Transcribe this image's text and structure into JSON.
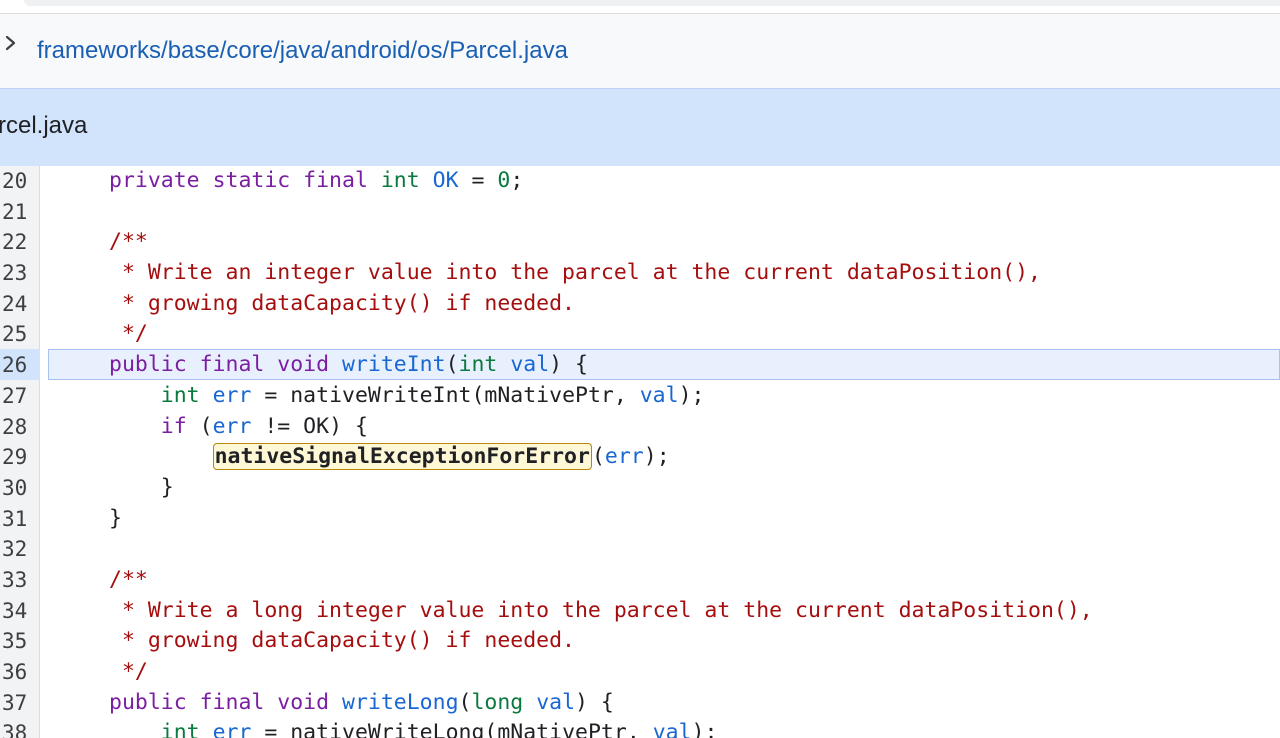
{
  "breadcrumb": {
    "path": "frameworks/base/core/java/android/os/Parcel.java"
  },
  "file_header": {
    "title": "rcel.java"
  },
  "code": {
    "highlighted_line": 26,
    "lines": [
      {
        "n": 20,
        "tokens": [
          {
            "t": "private ",
            "c": "kw"
          },
          {
            "t": "static ",
            "c": "kw"
          },
          {
            "t": "final ",
            "c": "kw"
          },
          {
            "t": "int ",
            "c": "ty"
          },
          {
            "t": "OK",
            "c": "fn"
          },
          {
            "t": " = ",
            "c": ""
          },
          {
            "t": "0",
            "c": "nm"
          },
          {
            "t": ";",
            "c": ""
          }
        ]
      },
      {
        "n": 21,
        "tokens": []
      },
      {
        "n": 22,
        "tokens": [
          {
            "t": "/**",
            "c": "cm"
          }
        ]
      },
      {
        "n": 23,
        "tokens": [
          {
            "t": " * Write an integer value into the parcel at the current dataPosition(),",
            "c": "cm"
          }
        ]
      },
      {
        "n": 24,
        "tokens": [
          {
            "t": " * growing dataCapacity() if needed.",
            "c": "cm"
          }
        ]
      },
      {
        "n": 25,
        "tokens": [
          {
            "t": " */",
            "c": "cm"
          }
        ]
      },
      {
        "n": 26,
        "tokens": [
          {
            "t": "public ",
            "c": "kw"
          },
          {
            "t": "final ",
            "c": "kw"
          },
          {
            "t": "void ",
            "c": "kw"
          },
          {
            "t": "writeInt",
            "c": "fn"
          },
          {
            "t": "(",
            "c": ""
          },
          {
            "t": "int ",
            "c": "ty"
          },
          {
            "t": "val",
            "c": "fn"
          },
          {
            "t": ") {",
            "c": ""
          }
        ]
      },
      {
        "n": 27,
        "tokens": [
          {
            "t": "    ",
            "c": ""
          },
          {
            "t": "int ",
            "c": "ty"
          },
          {
            "t": "err",
            "c": "fn"
          },
          {
            "t": " = nativeWriteInt(mNativePtr, ",
            "c": ""
          },
          {
            "t": "val",
            "c": "fn"
          },
          {
            "t": ");",
            "c": ""
          }
        ]
      },
      {
        "n": 28,
        "tokens": [
          {
            "t": "    ",
            "c": ""
          },
          {
            "t": "if",
            "c": "kw"
          },
          {
            "t": " (",
            "c": ""
          },
          {
            "t": "err",
            "c": "fn"
          },
          {
            "t": " != OK) {",
            "c": ""
          }
        ]
      },
      {
        "n": 29,
        "tokens": [
          {
            "t": "        ",
            "c": ""
          },
          {
            "t": "nativeSignalExceptionForError",
            "c": "ref"
          },
          {
            "t": "(",
            "c": ""
          },
          {
            "t": "err",
            "c": "fn"
          },
          {
            "t": ");",
            "c": ""
          }
        ]
      },
      {
        "n": 30,
        "tokens": [
          {
            "t": "    }",
            "c": ""
          }
        ]
      },
      {
        "n": 31,
        "tokens": [
          {
            "t": "}",
            "c": ""
          }
        ]
      },
      {
        "n": 32,
        "tokens": []
      },
      {
        "n": 33,
        "tokens": [
          {
            "t": "/**",
            "c": "cm"
          }
        ]
      },
      {
        "n": 34,
        "tokens": [
          {
            "t": " * Write a long integer value into the parcel at the current dataPosition(),",
            "c": "cm"
          }
        ]
      },
      {
        "n": 35,
        "tokens": [
          {
            "t": " * growing dataCapacity() if needed.",
            "c": "cm"
          }
        ]
      },
      {
        "n": 36,
        "tokens": [
          {
            "t": " */",
            "c": "cm"
          }
        ]
      },
      {
        "n": 37,
        "tokens": [
          {
            "t": "public ",
            "c": "kw"
          },
          {
            "t": "final ",
            "c": "kw"
          },
          {
            "t": "void ",
            "c": "kw"
          },
          {
            "t": "writeLong",
            "c": "fn"
          },
          {
            "t": "(",
            "c": ""
          },
          {
            "t": "long ",
            "c": "ty"
          },
          {
            "t": "val",
            "c": "fn"
          },
          {
            "t": ") {",
            "c": ""
          }
        ]
      },
      {
        "n": 38,
        "tokens": [
          {
            "t": "    ",
            "c": ""
          },
          {
            "t": "int ",
            "c": "ty"
          },
          {
            "t": "err",
            "c": "fn"
          },
          {
            "t": " = nativeWriteLong(mNativePtr, ",
            "c": ""
          },
          {
            "t": "val",
            "c": "fn"
          },
          {
            "t": ");",
            "c": ""
          }
        ]
      }
    ]
  },
  "icons": {
    "breadcrumb_chevron": "chevron-right-icon"
  },
  "colors": {
    "link": "#1a5fb4",
    "header_bg": "#d2e3fc",
    "keyword": "#7b1fa2",
    "type": "#0b7a3e",
    "identifier": "#1967d2",
    "comment": "#a50e0e",
    "highlight_line": "#e8f0fe",
    "reference_box": "#b8860b"
  }
}
